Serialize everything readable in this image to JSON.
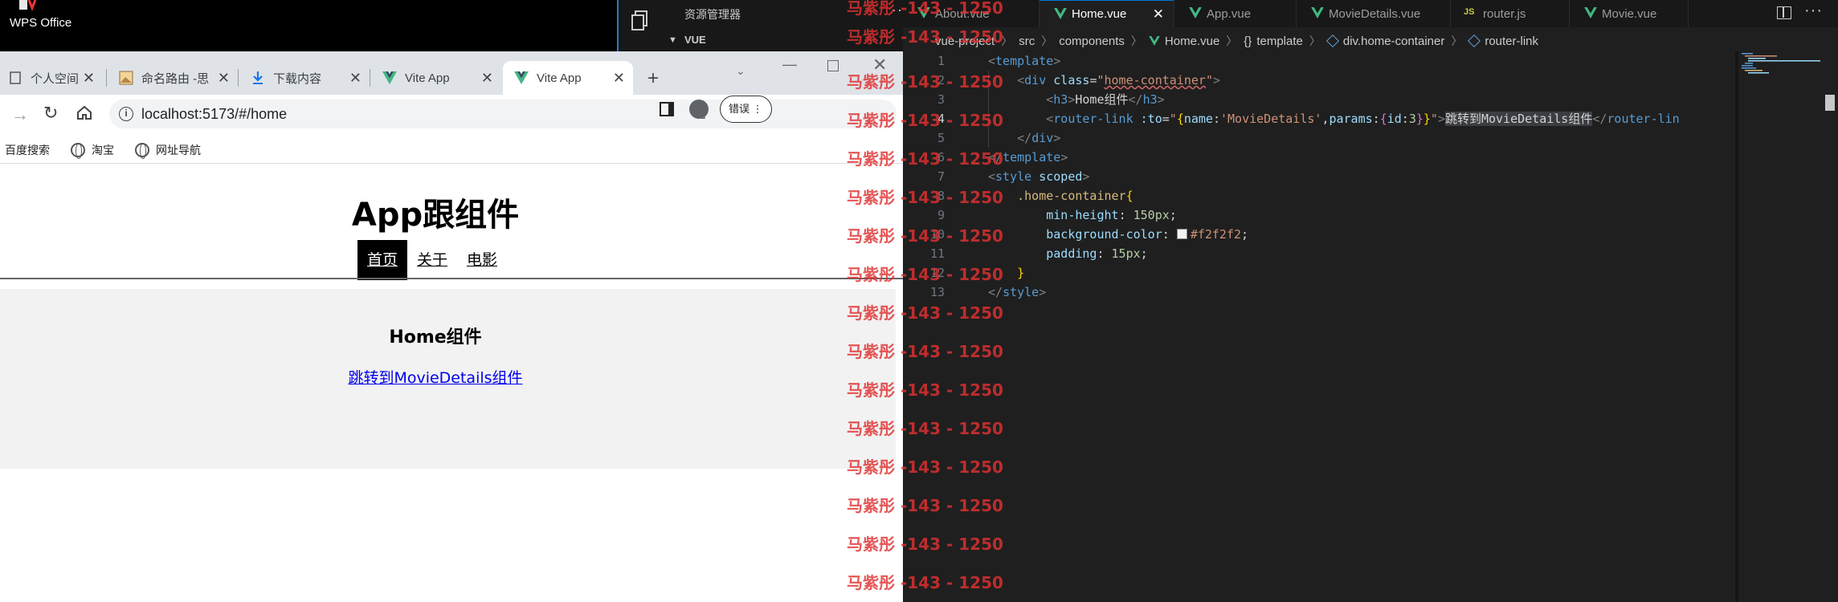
{
  "desktop": {
    "app_label": "WPS Office",
    "explorer_title": "资源管理器",
    "explorer_more": "···",
    "explorer_folder": "VUE"
  },
  "browser": {
    "tabs": [
      {
        "label": "个人空间",
        "icon": "page-icon"
      },
      {
        "label": "命名路由 -思",
        "icon": "image-icon"
      },
      {
        "label": "下载内容",
        "icon": "download-icon"
      },
      {
        "label": "Vite App",
        "icon": "vue-icon"
      },
      {
        "label": "Vite App",
        "icon": "vue-icon",
        "active": true
      }
    ],
    "url": "localhost:5173/#/home",
    "error_button": "错误 ⋮",
    "bookmarks": [
      {
        "label": "百度搜索"
      },
      {
        "label": "淘宝"
      },
      {
        "label": "网址导航"
      }
    ]
  },
  "page": {
    "app_title": "App跟组件",
    "nav": [
      {
        "label": "首页",
        "active": true
      },
      {
        "label": "关于"
      },
      {
        "label": "电影"
      }
    ],
    "home_heading": "Home组件",
    "home_link": "跳转到MovieDetails组件"
  },
  "editor": {
    "tabs": [
      {
        "label": "About.vue",
        "kind": "vue"
      },
      {
        "label": "Home.vue",
        "kind": "vue",
        "active": true
      },
      {
        "label": "App.vue",
        "kind": "vue"
      },
      {
        "label": "MovieDetails.vue",
        "kind": "vue"
      },
      {
        "label": "router.js",
        "kind": "js"
      },
      {
        "label": "Movie.vue",
        "kind": "vue"
      }
    ],
    "breadcrumb": [
      "vue-project",
      "src",
      "components",
      "Home.vue",
      "template",
      "div.home-container",
      "router-link"
    ],
    "line_numbers": [
      "1",
      "2",
      "3",
      "4",
      "5",
      "6",
      "7",
      "8",
      "9",
      "10",
      "11",
      "12",
      "13"
    ],
    "current_line": "4",
    "code": {
      "l1_tag": "template",
      "l2_tag": "div",
      "l2_attr": "class",
      "l2_value": "home-container",
      "l3_tag": "h3",
      "l3_text": "Home组件",
      "l4_tag": "router-link",
      "l4_attr": ":to",
      "l4_key1": "name",
      "l4_val1": "'MovieDetails'",
      "l4_key2": "params",
      "l4_key3": "id",
      "l4_val3": "3",
      "l4_text": "跳转到MovieDetails组件",
      "l4_close": "router-lin",
      "l5_tag": "div",
      "l6_tag": "template",
      "l7_tag": "style",
      "l7_attr": "scoped",
      "l8_selector": ".home-container",
      "l9_prop": "min-height",
      "l9_value": "150px",
      "l10_prop": "background-color",
      "l10_value": "#f2f2f2",
      "l11_prop": "padding",
      "l11_value": "15px",
      "l13_tag": "style"
    }
  },
  "watermark": {
    "text": "马紫彤 -143 - 1250",
    "color": "#e03131"
  }
}
